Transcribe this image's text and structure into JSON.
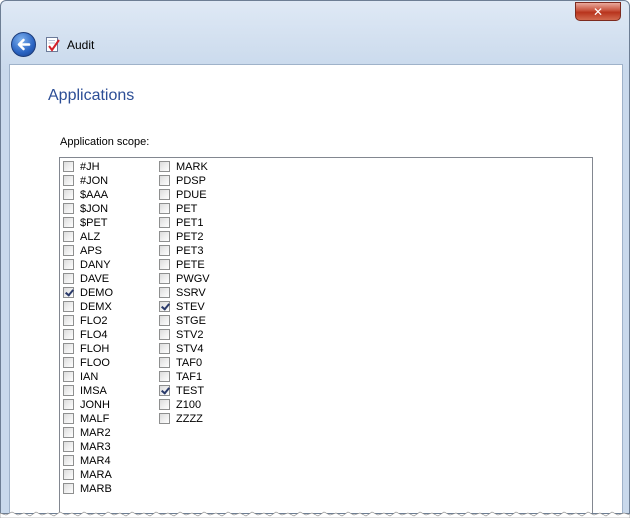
{
  "window": {
    "close_glyph": "✕"
  },
  "header": {
    "title": "Audit",
    "back_icon": "back-arrow-icon",
    "audit_icon": "audit-checklist-icon"
  },
  "page": {
    "heading": "Applications",
    "scope_label": "Application scope:"
  },
  "columns": [
    [
      {
        "label": "#JH",
        "checked": false
      },
      {
        "label": "#JON",
        "checked": false
      },
      {
        "label": "$AAA",
        "checked": false
      },
      {
        "label": "$JON",
        "checked": false
      },
      {
        "label": "$PET",
        "checked": false
      },
      {
        "label": "ALZ",
        "checked": false
      },
      {
        "label": "APS",
        "checked": false
      },
      {
        "label": "DANY",
        "checked": false
      },
      {
        "label": "DAVE",
        "checked": false
      },
      {
        "label": "DEMO",
        "checked": true
      },
      {
        "label": "DEMX",
        "checked": false
      },
      {
        "label": "FLO2",
        "checked": false
      },
      {
        "label": "FLO4",
        "checked": false
      },
      {
        "label": "FLOH",
        "checked": false
      },
      {
        "label": "FLOO",
        "checked": false
      },
      {
        "label": "IAN",
        "checked": false
      },
      {
        "label": "IMSA",
        "checked": false
      },
      {
        "label": "JONH",
        "checked": false
      },
      {
        "label": "MALF",
        "checked": false
      },
      {
        "label": "MAR2",
        "checked": false
      },
      {
        "label": "MAR3",
        "checked": false
      },
      {
        "label": "MAR4",
        "checked": false
      },
      {
        "label": "MARA",
        "checked": false
      },
      {
        "label": "MARB",
        "checked": false
      }
    ],
    [
      {
        "label": "MARK",
        "checked": false
      },
      {
        "label": "PDSP",
        "checked": false
      },
      {
        "label": "PDUE",
        "checked": false
      },
      {
        "label": "PET",
        "checked": false
      },
      {
        "label": "PET1",
        "checked": false
      },
      {
        "label": "PET2",
        "checked": false
      },
      {
        "label": "PET3",
        "checked": false
      },
      {
        "label": "PETE",
        "checked": false
      },
      {
        "label": "PWGV",
        "checked": false
      },
      {
        "label": "SSRV",
        "checked": false
      },
      {
        "label": "STEV",
        "checked": true
      },
      {
        "label": "STGE",
        "checked": false
      },
      {
        "label": "STV2",
        "checked": false
      },
      {
        "label": "STV4",
        "checked": false
      },
      {
        "label": "TAF0",
        "checked": false
      },
      {
        "label": "TAF1",
        "checked": false
      },
      {
        "label": "TEST",
        "checked": true
      },
      {
        "label": "Z100",
        "checked": false
      },
      {
        "label": "ZZZZ",
        "checked": false
      }
    ]
  ]
}
